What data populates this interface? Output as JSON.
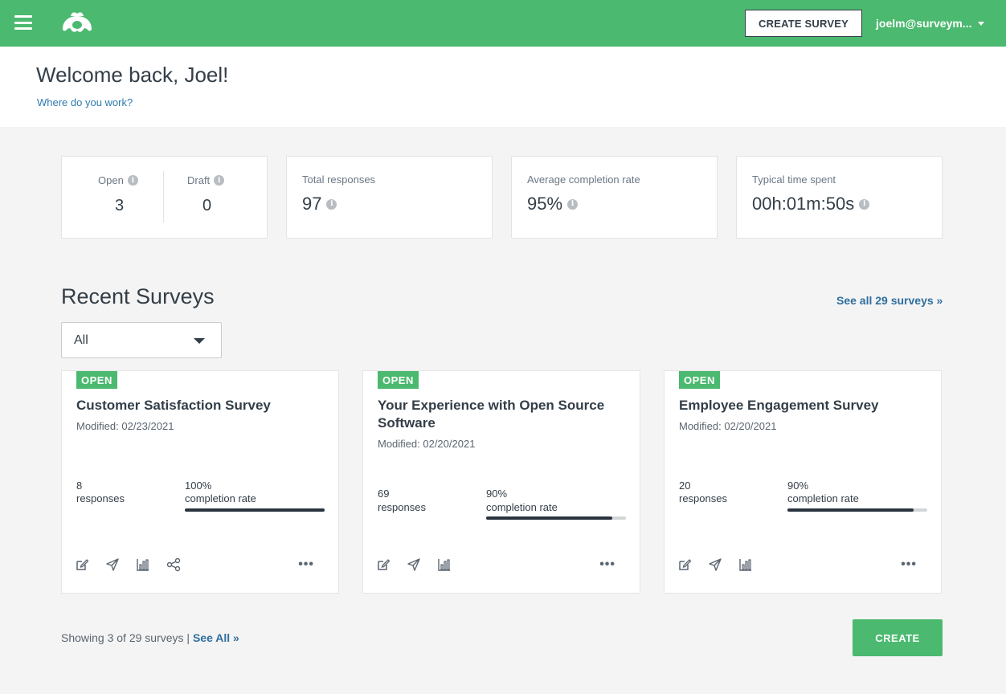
{
  "header": {
    "create_survey_label": "CREATE SURVEY",
    "user_email": "joelm@surveym...",
    "brand_color": "#4bb96f"
  },
  "welcome": {
    "title": "Welcome back, Joel!",
    "work_link": "Where do you work?"
  },
  "stats": {
    "open_label": "Open",
    "open_value": "3",
    "draft_label": "Draft",
    "draft_value": "0",
    "total_label": "Total responses",
    "total_value": "97",
    "completion_label": "Average completion rate",
    "completion_value": "95%",
    "time_label": "Typical time spent",
    "time_value": "00h:01m:50s",
    "info_icon": "i"
  },
  "recent": {
    "title": "Recent Surveys",
    "see_all_label": "See all 29 surveys »",
    "filter_value": "All"
  },
  "surveys": [
    {
      "status": "OPEN",
      "title": "Customer Satisfaction Survey",
      "modified": "Modified: 02/23/2021",
      "responses": "8",
      "responses_label": "responses",
      "rate": "100%",
      "rate_label": "completion rate",
      "rate_fraction": 1.0,
      "actions": [
        "edit-icon",
        "send-icon",
        "analyze-icon",
        "share-icon"
      ],
      "more": "•••"
    },
    {
      "status": "OPEN",
      "title": "Your Experience with Open Source Software",
      "modified": "Modified: 02/20/2021",
      "responses": "69",
      "responses_label": "responses",
      "rate": "90%",
      "rate_label": "completion rate",
      "rate_fraction": 0.9,
      "actions": [
        "edit-icon",
        "send-icon",
        "analyze-icon"
      ],
      "more": "•••"
    },
    {
      "status": "OPEN",
      "title": "Employee Engagement Survey",
      "modified": "Modified: 02/20/2021",
      "responses": "20",
      "responses_label": "responses",
      "rate": "90%",
      "rate_label": "completion rate",
      "rate_fraction": 0.9,
      "actions": [
        "edit-icon",
        "send-icon",
        "analyze-icon"
      ],
      "more": "•••"
    }
  ],
  "footer": {
    "showing_text": "Showing 3 of 29 surveys | ",
    "see_all_label": "See All »",
    "create_label": "CREATE"
  }
}
